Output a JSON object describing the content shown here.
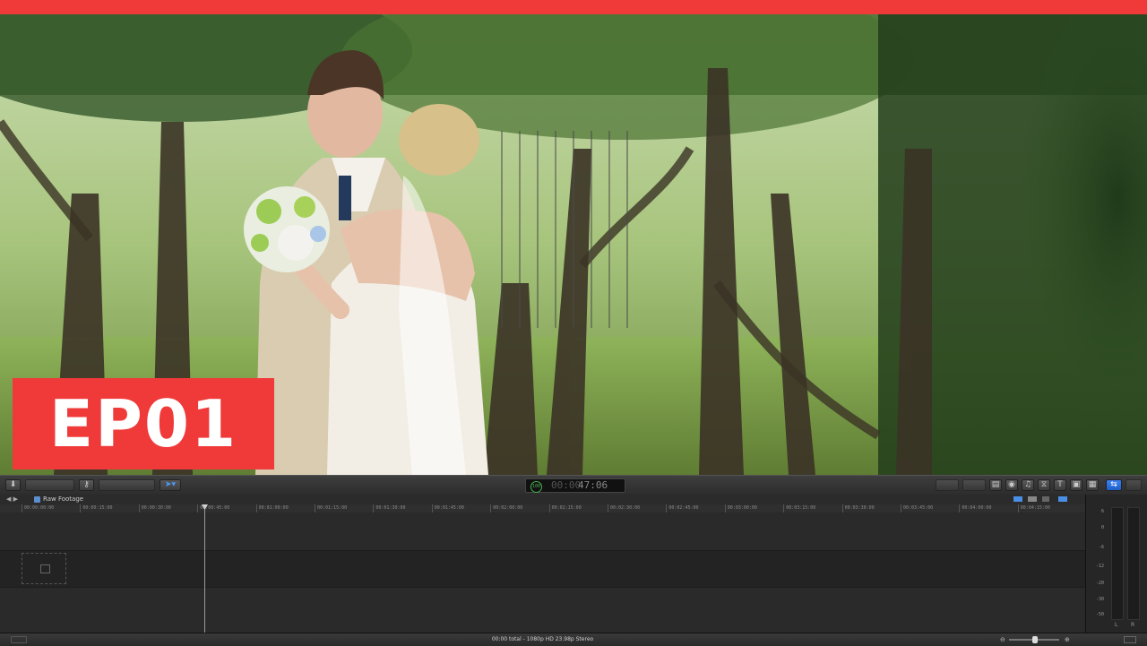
{
  "colors": {
    "brand_red": "#f03a3a",
    "accent_blue": "#2f74e6",
    "bg_dark": "#1a1a1a"
  },
  "overlay": {
    "episode_badge": "EP01"
  },
  "toolbar": {
    "tools_icon": "arrow-select-icon",
    "timecode": {
      "percent": "100",
      "leading": "00:00",
      "main": "47:06"
    }
  },
  "timeline": {
    "project_name": "Raw Footage",
    "ruler_ticks": [
      "00:00:00:00",
      "00:00:15:00",
      "00:00:30:00",
      "00:00:45:00",
      "00:01:00:00",
      "00:01:15:00",
      "00:01:30:00",
      "00:01:45:00",
      "00:02:00:00",
      "00:02:15:00",
      "00:02:30:00",
      "00:02:45:00",
      "00:03:00:00",
      "00:03:15:00",
      "00:03:30:00",
      "00:03:45:00",
      "00:04:00:00",
      "00:04:15:00"
    ]
  },
  "audio_meters": {
    "scale": [
      "6",
      "0",
      "-6",
      "-12",
      "-20",
      "-30",
      "-50"
    ],
    "channels": [
      "L",
      "R"
    ]
  },
  "status": {
    "summary": "00:00 total - 1080p HD 23.98p Stereo"
  }
}
